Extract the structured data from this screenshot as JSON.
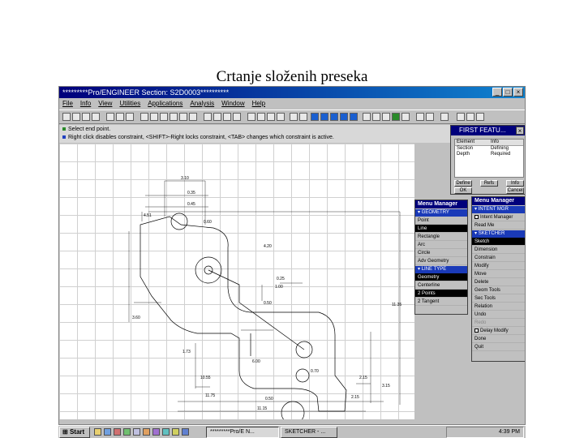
{
  "slide_title": "Crtanje složenih preseka",
  "window": {
    "title": "*********Pro/ENGINEER Section: S2D0003**********",
    "controls": [
      "_",
      "□",
      "×"
    ]
  },
  "menubar": [
    "File",
    "Info",
    "View",
    "Utilities",
    "Applications",
    "Analysis",
    "Window",
    "Help"
  ],
  "messages": [
    "Select end point.",
    "Right click disables constraint, <SHIFT>-Right locks constraint, <TAB> changes which constraint is active."
  ],
  "first_feature": {
    "title": "FIRST FEATU...",
    "columns": [
      "Element",
      "Info"
    ],
    "rows": [
      {
        "element": "Section",
        "info": "Defining"
      },
      {
        "element": "Depth",
        "info": "Required"
      }
    ],
    "buttons": [
      "Define",
      "Refs",
      "Info",
      "OK",
      "Cancel"
    ]
  },
  "menu_left": {
    "title": "Menu Manager",
    "geometry_header": "GEOMETRY",
    "geometry_items": [
      "Point",
      "Line",
      "Rectangle",
      "Arc",
      "Circle",
      "Adv Geometry"
    ],
    "geometry_selected": "Line",
    "linetype_header": "LINE TYPE",
    "linetype_items": [
      "Geometry",
      "Centerline",
      "2 Points",
      "2 Tangent"
    ],
    "linetype_selected": [
      "Geometry",
      "2 Points"
    ]
  },
  "menu_right": {
    "title": "Menu Manager",
    "intent_header": "INTENT MGR",
    "intent_items": [
      "Intent Manager",
      "Read Me"
    ],
    "sketcher_header": "SKETCHER",
    "sketcher_items": [
      "Sketch",
      "Dimension",
      "Constrain",
      "Modify",
      "Move",
      "Delete",
      "Geom Tools",
      "Sec Tools",
      "Relation",
      "Undo",
      "Redo",
      "Delay Modify",
      "Done",
      "Quit"
    ],
    "sketcher_selected": "Sketch",
    "sketcher_disabled": [
      "Redo"
    ]
  },
  "dimensions": [
    "3.10",
    "0.35",
    "0.45",
    "4.51",
    "0.60",
    "4.20",
    "3.60",
    "0.25",
    "0.50",
    "1.00",
    "11.35",
    "1.73",
    "6.00",
    "10.55",
    "0.70",
    "11.75",
    "2.15",
    "3.15",
    "0.50",
    "2.15",
    "11.15"
  ],
  "taskbar": {
    "start": "Start",
    "tasks": [
      "*********Pro/E N...",
      "SKETCHER - ..."
    ],
    "clock": "4:39 PM"
  }
}
